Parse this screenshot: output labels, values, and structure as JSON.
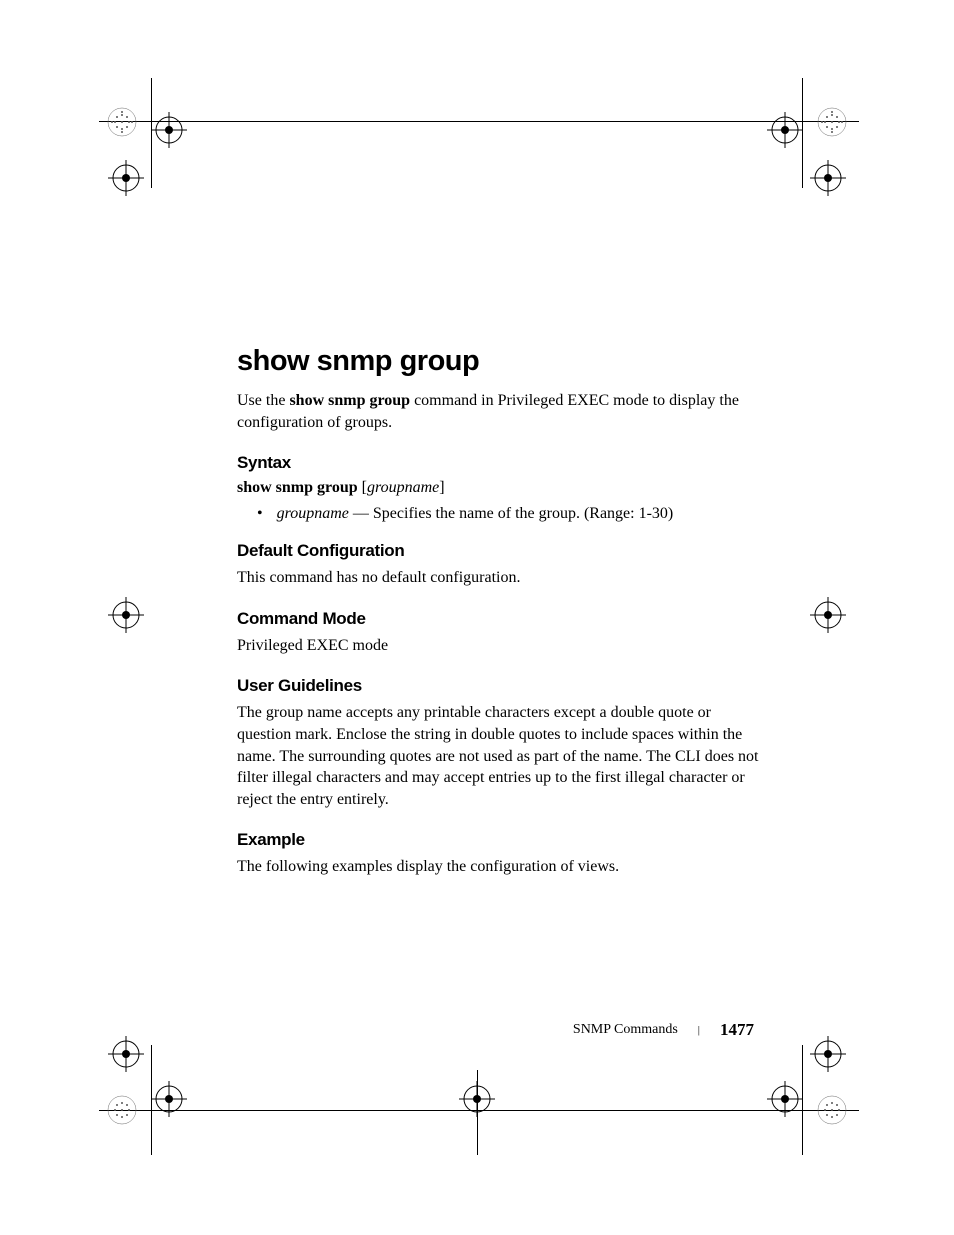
{
  "title": "show snmp group",
  "intro_prefix": "Use the ",
  "intro_bold": "show snmp group",
  "intro_suffix": " command in Privileged EXEC mode to display the configuration of groups.",
  "sections": {
    "syntax": {
      "header": "Syntax",
      "command_bold": "show snmp group ",
      "param_open": "[",
      "param_italic": "groupname",
      "param_close": "]",
      "bullet_italic": "groupname",
      "bullet_text": " — Specifies the name of the group. (Range: 1-30)"
    },
    "default_config": {
      "header": "Default Configuration",
      "text": "This command has no default configuration."
    },
    "command_mode": {
      "header": "Command Mode",
      "text": "Privileged EXEC mode"
    },
    "user_guidelines": {
      "header": "User Guidelines",
      "text": "The group name accepts any printable characters except a double quote or question mark. Enclose the string in double quotes to include spaces within the name. The surrounding quotes are not used as part of the name. The CLI does not filter illegal characters and may accept entries up to the first illegal character or reject the entry entirely."
    },
    "example": {
      "header": "Example",
      "text": "The following examples display the configuration of views."
    }
  },
  "footer": {
    "section": "SNMP Commands",
    "page": "1477"
  }
}
